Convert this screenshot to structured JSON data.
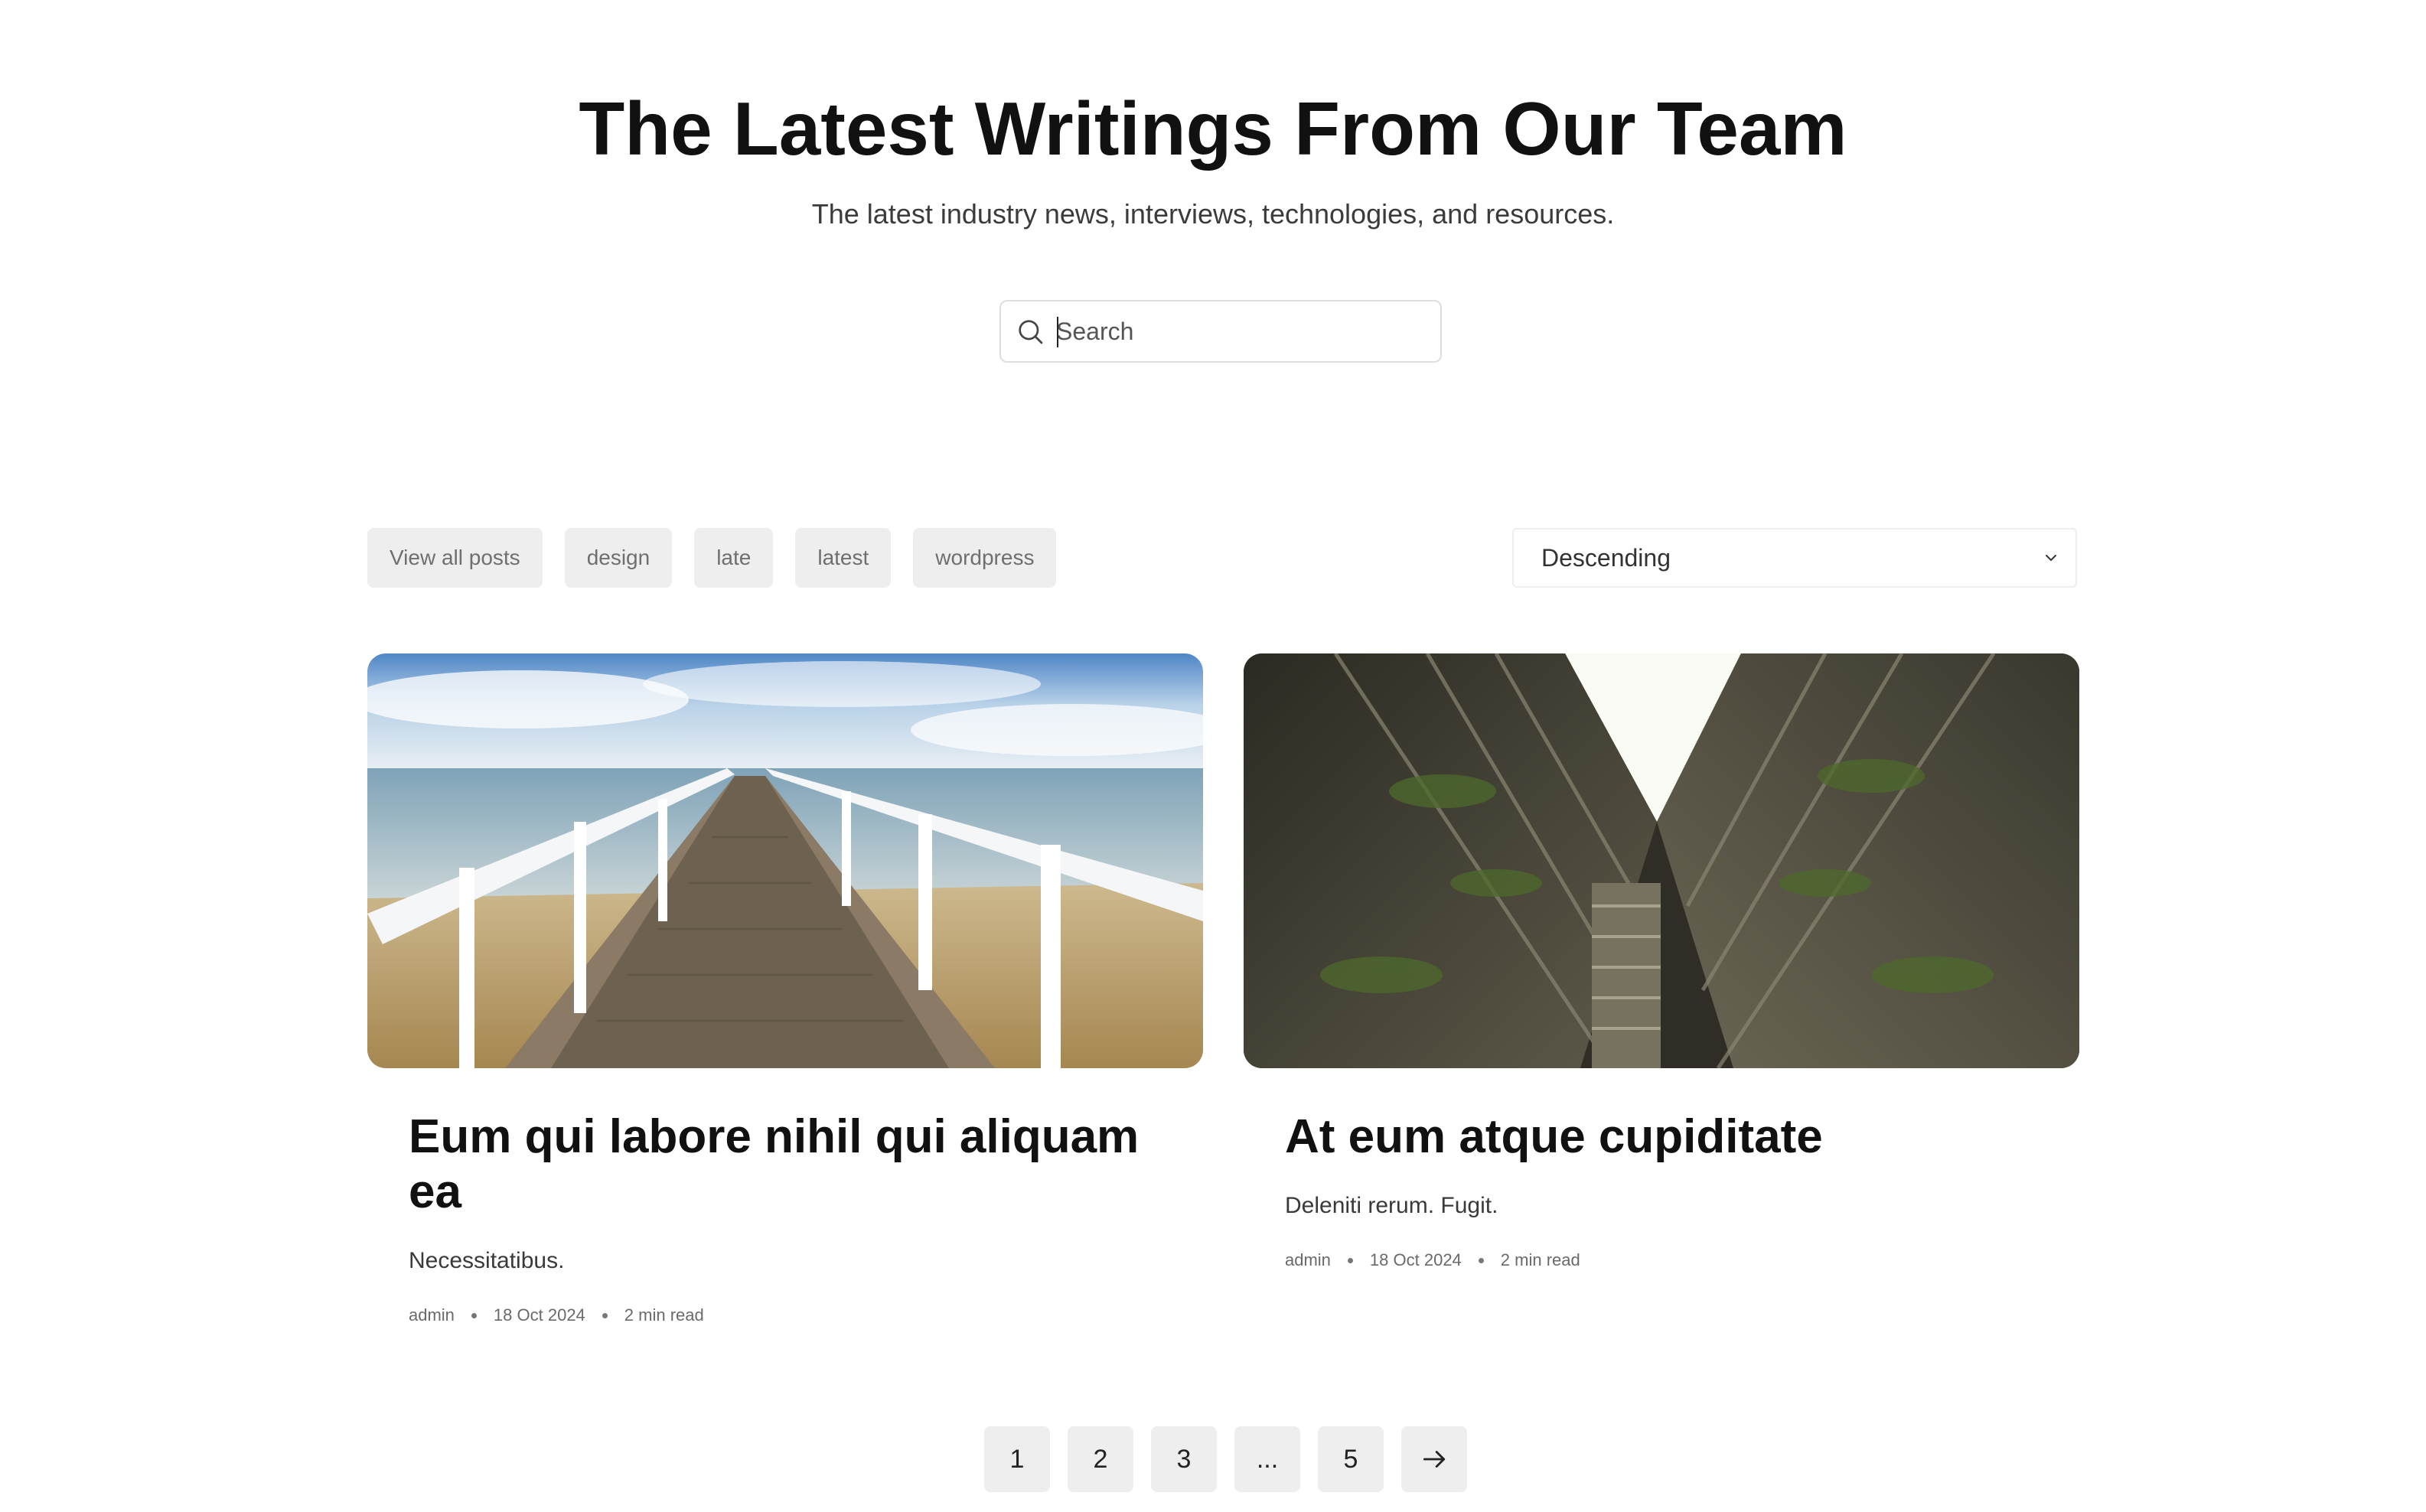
{
  "hero": {
    "title": "The Latest Writings From Our Team",
    "subtitle": "The latest industry news, interviews, technologies, and resources."
  },
  "search": {
    "placeholder": "Search",
    "value": "",
    "icon": "search-icon"
  },
  "filters": [
    "View all posts",
    "design",
    "late",
    "latest",
    "wordpress"
  ],
  "sort": {
    "selected": "Descending",
    "icon": "chevron-down-icon"
  },
  "posts": [
    {
      "title": "Eum qui labore nihil qui aliquam ea",
      "excerpt": "Necessitatibus.",
      "author": "admin",
      "date": "18 Oct 2024",
      "read_time": "2 min read",
      "image": "pier-over-sea-photo"
    },
    {
      "title": "At eum atque cupiditate",
      "excerpt": "Deleniti rerum. Fugit.",
      "author": "admin",
      "date": "18 Oct 2024",
      "read_time": "2 min read",
      "image": "building-courtyard-looking-up-photo"
    }
  ],
  "pagination": {
    "pages": [
      "1",
      "2",
      "3",
      "...",
      "5"
    ],
    "next_icon": "arrow-right-icon"
  },
  "colors": {
    "text": "#111111",
    "muted": "#6f6f6f",
    "chip_bg": "#eeeeee",
    "border": "#dedede"
  }
}
